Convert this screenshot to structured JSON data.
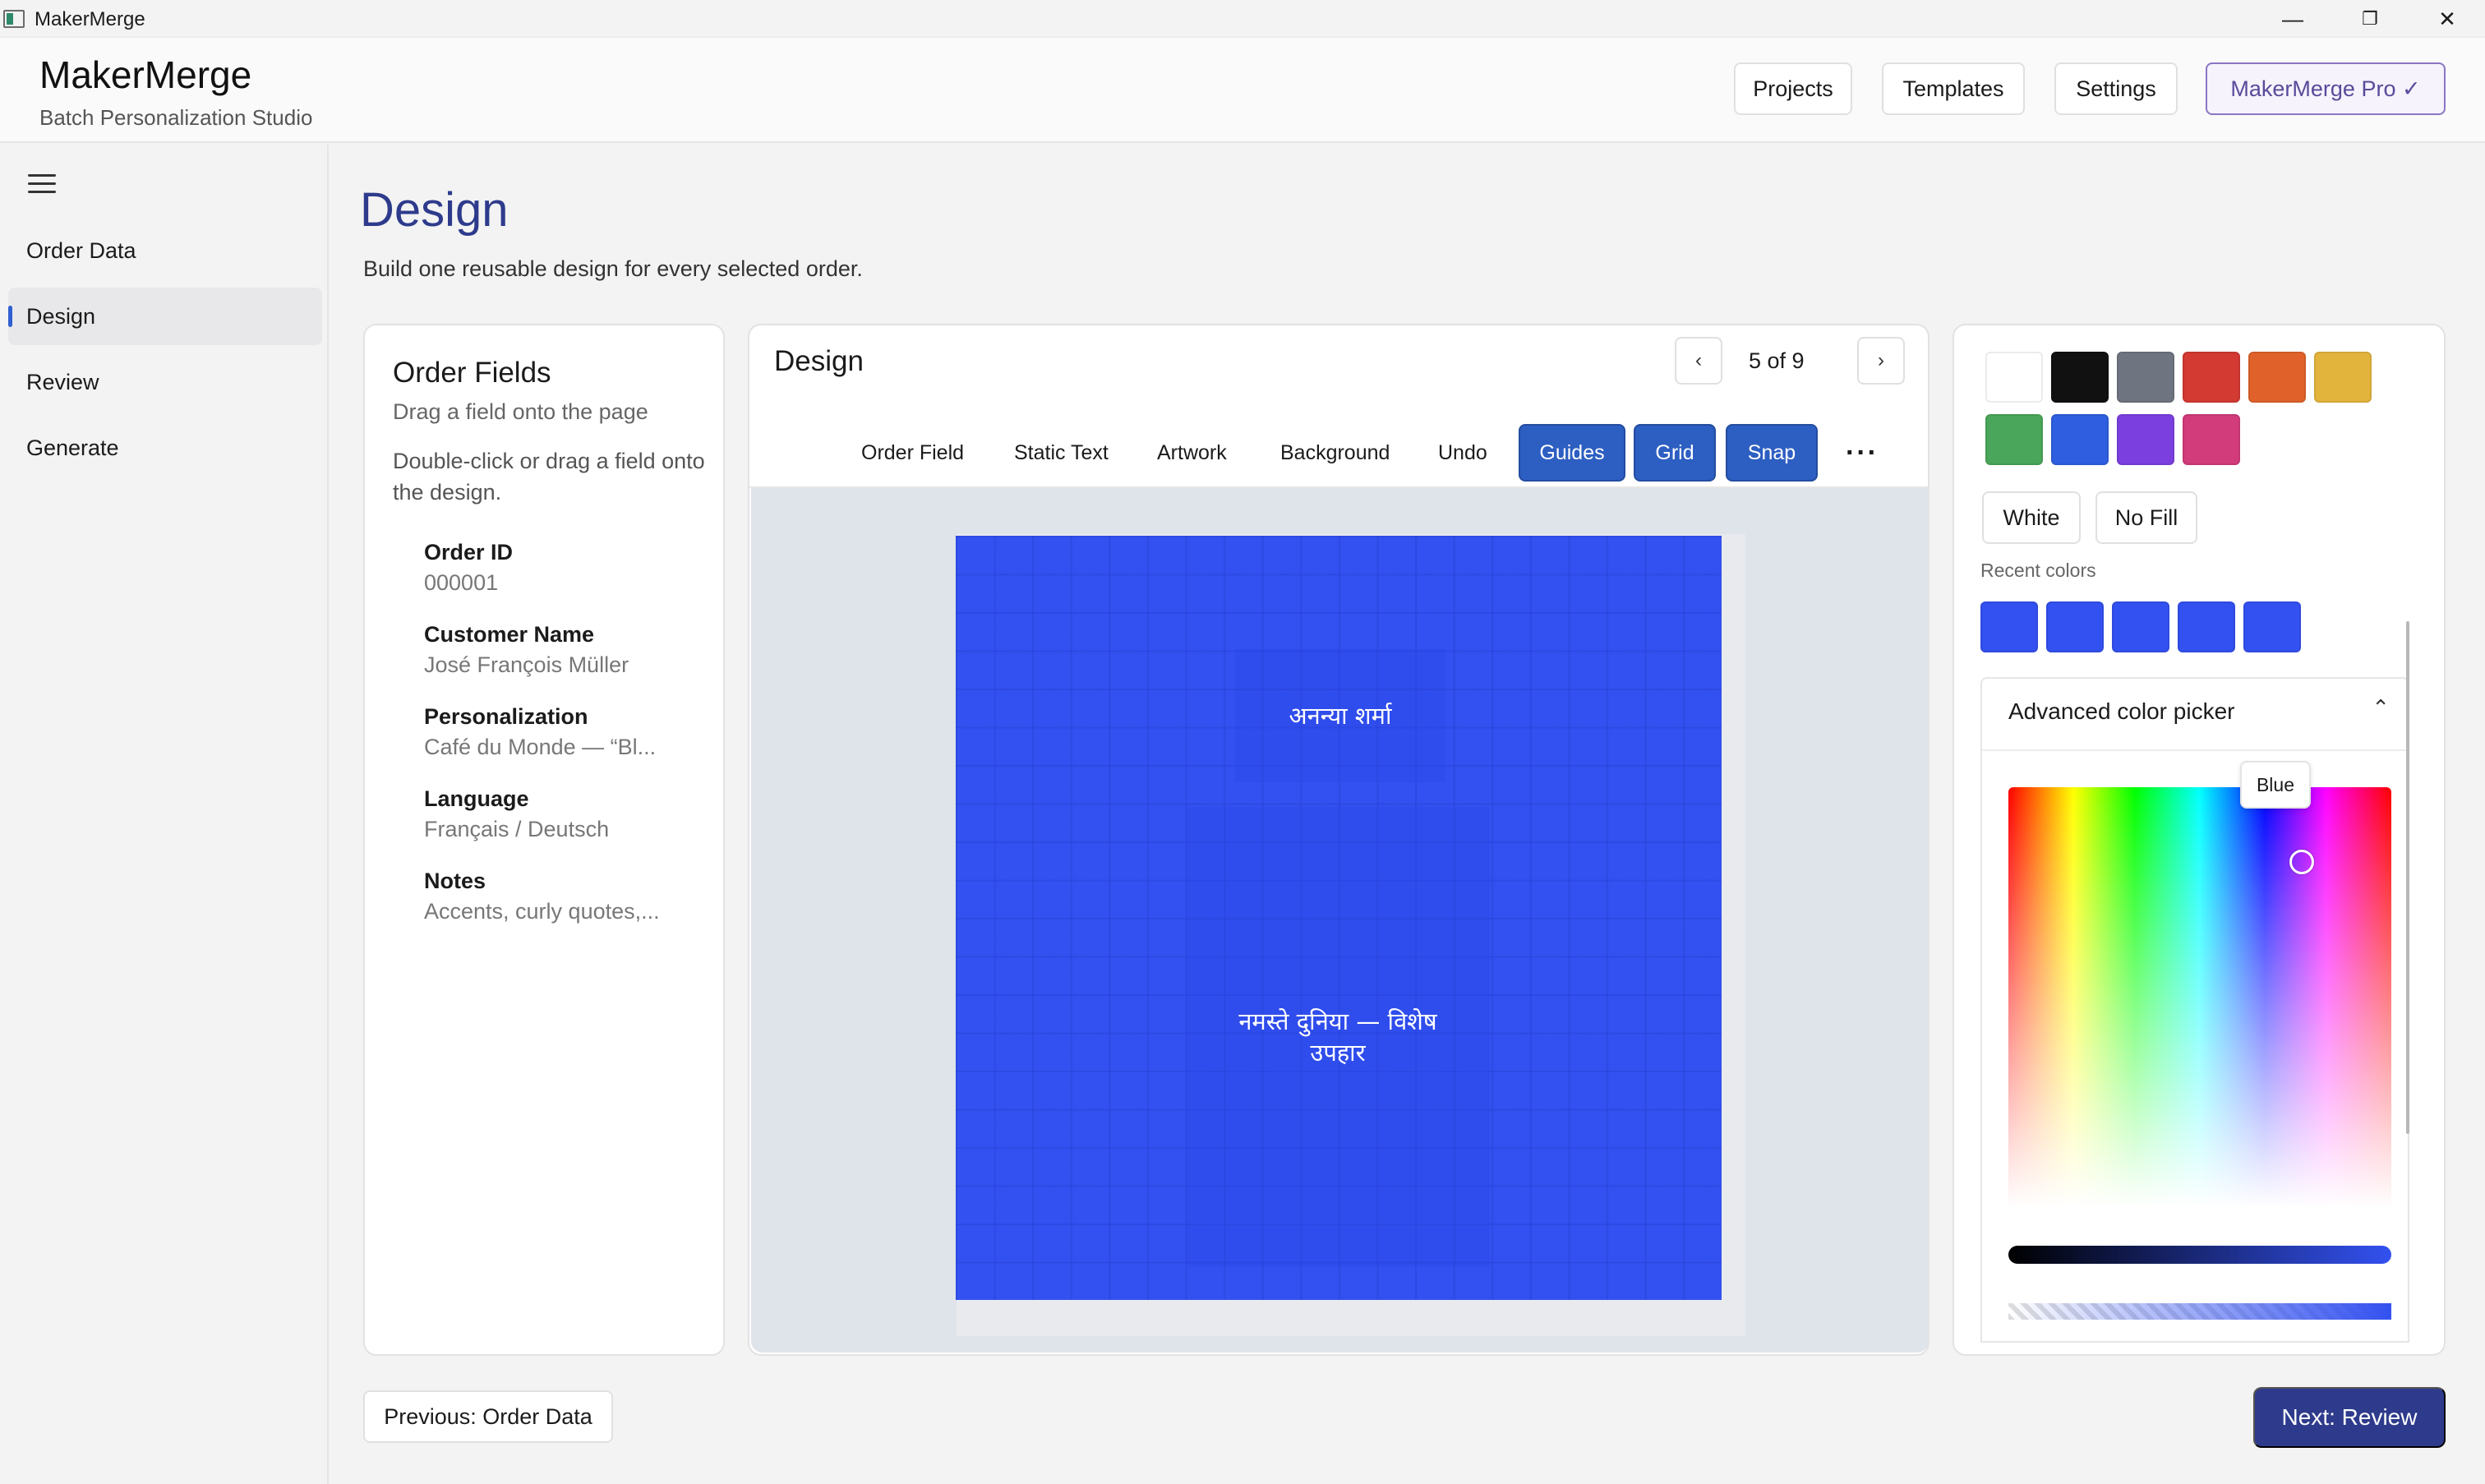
{
  "window": {
    "title": "MakerMerge",
    "minimize": "—",
    "restore": "❐",
    "close": "✕"
  },
  "header": {
    "brand": "MakerMerge",
    "subtitle": "Batch Personalization Studio",
    "nav": {
      "projects": "Projects",
      "templates": "Templates",
      "settings": "Settings",
      "pro": "MakerMerge Pro ✓"
    }
  },
  "sidebar": {
    "items": [
      {
        "label": "Order Data"
      },
      {
        "label": "Design"
      },
      {
        "label": "Review"
      },
      {
        "label": "Generate"
      }
    ],
    "active": "Design"
  },
  "page": {
    "title": "Design",
    "subtitle": "Build one reusable design for every selected order."
  },
  "order_fields": {
    "title": "Order Fields",
    "hint": "Drag a field onto the page",
    "hint2": "Double-click or drag a field onto the design.",
    "fields": [
      {
        "name": "Order ID",
        "value": "000001"
      },
      {
        "name": "Customer Name",
        "value": "José François Müller"
      },
      {
        "name": "Personalization",
        "value": "Café du Monde — “Bl..."
      },
      {
        "name": "Language",
        "value": "Français / Deutsch"
      },
      {
        "name": "Notes",
        "value": "Accents, curly quotes,..."
      }
    ]
  },
  "design": {
    "title": "Design",
    "pager": {
      "prev": "‹",
      "text": "5 of 9",
      "next": "›"
    },
    "tools": {
      "order_field": "Order Field",
      "static_text": "Static Text",
      "artwork": "Artwork",
      "background": "Background",
      "undo": "Undo",
      "guides": "Guides",
      "grid": "Grid",
      "snap": "Snap",
      "more": "···"
    },
    "canvas": {
      "background_color": "#3351F0",
      "text1": "अनन्या शर्मा",
      "text2": "नमस्ते दुनिया — विशेष उपहार"
    }
  },
  "color_panel": {
    "swatches": [
      "#FFFFFF",
      "#111111",
      "#6E7480",
      "#D23A32",
      "#E0622A",
      "#E3B43C",
      "#4AA65A",
      "#2F5FE0",
      "#7B3FE0",
      "#D23C7A"
    ],
    "white_button": "White",
    "no_fill_button": "No Fill",
    "recent_label": "Recent colors",
    "recent": [
      "#3351F0",
      "#3351F0",
      "#3351F0",
      "#3351F0",
      "#3351F0"
    ],
    "advanced_label": "Advanced color picker",
    "chevron": "⌃",
    "tooltip": "Blue"
  },
  "footer": {
    "prev": "Previous: Order Data",
    "next": "Next: Review"
  }
}
